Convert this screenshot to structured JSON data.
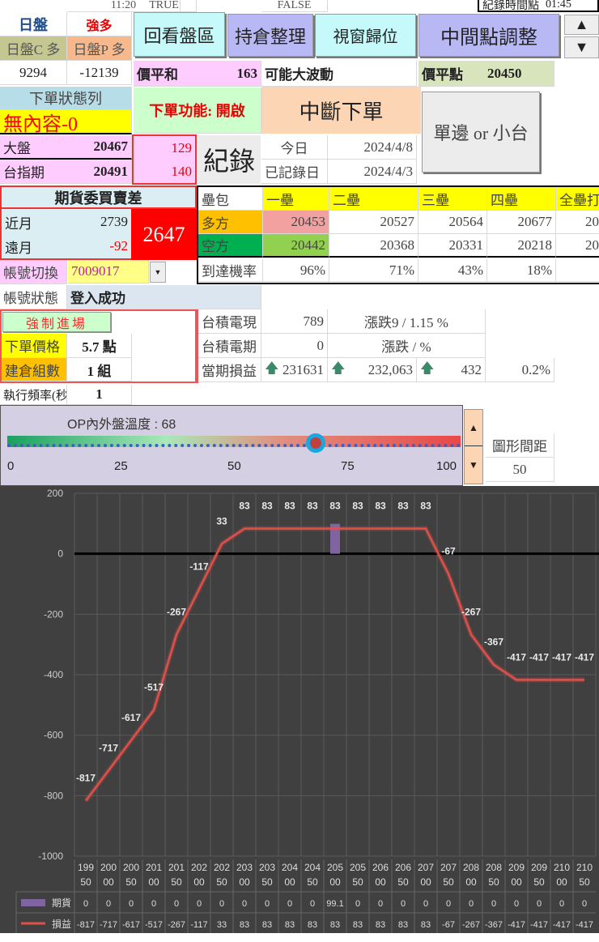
{
  "top_row": {
    "time": "11:20",
    "flag1": "TRUE",
    "flag2": "FALSE",
    "record_time_label": "紀錄時間點",
    "record_time": "01:45"
  },
  "day_session": {
    "label": "日盤",
    "trend": "強多",
    "call_label": "日盤C 多",
    "put_label": "日盤P 多",
    "call_value": "9294",
    "put_value": "-12139"
  },
  "buttons": {
    "review": "回看盤區",
    "positions": "持倉整理",
    "reset_window": "視窗歸位",
    "midpoint_adjust": "中間點調整",
    "interrupt_order": "中斷下單",
    "single_side": "單邊 or 小台",
    "record": "紀錄",
    "force_entry": "強制進場",
    "up": "▲",
    "down": "▼"
  },
  "atm_sum": {
    "label": "價平和",
    "value": "163",
    "note": "可能大波動"
  },
  "atm_point": {
    "label": "價平點",
    "value": "20450"
  },
  "order_status": {
    "header": "下單狀態列",
    "content": "無內容-0",
    "function_label": "下單功能: 開啟"
  },
  "index": {
    "taiex_label": "大盤",
    "taiex": "20467",
    "taiex_diff": "129",
    "futures_label": "台指期",
    "futures": "20491",
    "futures_diff": "140"
  },
  "dates": {
    "today_label": "今日",
    "today": "2024/4/8",
    "recorded_label": "已記錄日",
    "recorded": "2024/4/3"
  },
  "order_book": {
    "title": "期貨委買賣差",
    "near_label": "近月",
    "near": "2739",
    "far_label": "遠月",
    "far": "-92",
    "total": "2647"
  },
  "bases": {
    "header": [
      "壘包",
      "一壘",
      "二壘",
      "三壘",
      "四壘",
      "全壘打"
    ],
    "long": [
      "多方",
      "20453",
      "20527",
      "20564",
      "20677",
      "20"
    ],
    "short": [
      "空方",
      "20442",
      "20368",
      "20331",
      "20218",
      "20"
    ],
    "prob": [
      "到達機率",
      "96%",
      "71%",
      "43%",
      "18%",
      ""
    ]
  },
  "account": {
    "switch_label": "帳號切換",
    "id": "7009017",
    "status_label": "帳號狀態",
    "status": "登入成功"
  },
  "order_params": {
    "price_label": "下單價格",
    "price": "5.7 點",
    "lots_label": "建倉組數",
    "lots": "1 組",
    "freq_label": "執行頻率(秒",
    "freq": "1"
  },
  "tsmc": {
    "spot_label": "台積電現",
    "spot": "789",
    "spot_change": "漲跌9 / 1.15 %",
    "fut_label": "台積電期",
    "fut": "0",
    "fut_change": "漲跌 /  %",
    "pnl_label": "當期損益",
    "pnl1": "231631",
    "pnl2": "232,063",
    "pnl3": "432",
    "pnl_pct": "0.2%"
  },
  "gauge": {
    "title": "OP內外盤溫度 : 68",
    "value": 68,
    "ticks": [
      "0",
      "25",
      "50",
      "75",
      "100"
    ]
  },
  "spacing": {
    "label": "圖形間距",
    "value": "50"
  },
  "colors": {
    "chart_bg": "#404040",
    "loss_line": "#e0504a",
    "futures_bar": "#8064a2"
  },
  "chart_data": {
    "type": "line",
    "title": "",
    "ylim": [
      -1000,
      200
    ],
    "yticks": [
      "200",
      "0",
      "-200",
      "-400",
      "-600",
      "-800",
      "-1000"
    ],
    "categories": [
      [
        "199",
        "50"
      ],
      [
        "200",
        "00"
      ],
      [
        "200",
        "50"
      ],
      [
        "201",
        "00"
      ],
      [
        "201",
        "50"
      ],
      [
        "202",
        "00"
      ],
      [
        "202",
        "50"
      ],
      [
        "203",
        "00"
      ],
      [
        "203",
        "50"
      ],
      [
        "204",
        "00"
      ],
      [
        "204",
        "50"
      ],
      [
        "205",
        "00"
      ],
      [
        "205",
        "50"
      ],
      [
        "206",
        "00"
      ],
      [
        "206",
        "50"
      ],
      [
        "207",
        "00"
      ],
      [
        "207",
        "50"
      ],
      [
        "208",
        "00"
      ],
      [
        "208",
        "50"
      ],
      [
        "209",
        "00"
      ],
      [
        "209",
        "50"
      ],
      [
        "210",
        "00"
      ],
      [
        "210",
        "50"
      ]
    ],
    "series": [
      {
        "name": "期貨",
        "type": "bar",
        "values": [
          "0",
          "0",
          "0",
          "0",
          "0",
          "0",
          "0",
          "0",
          "0",
          "0",
          "0",
          "99.1",
          "0",
          "0",
          "0",
          "0",
          "0",
          "0",
          "0",
          "0",
          "0",
          "0",
          "0"
        ]
      },
      {
        "name": "損益",
        "type": "line",
        "values": [
          "-817",
          "-717",
          "-617",
          "-517",
          "-267",
          "-117",
          "33",
          "83",
          "83",
          "83",
          "83",
          "83",
          "83",
          "83",
          "83",
          "83",
          "-67",
          "-267",
          "-367",
          "-417",
          "-417",
          "-417",
          "-417"
        ]
      }
    ]
  }
}
